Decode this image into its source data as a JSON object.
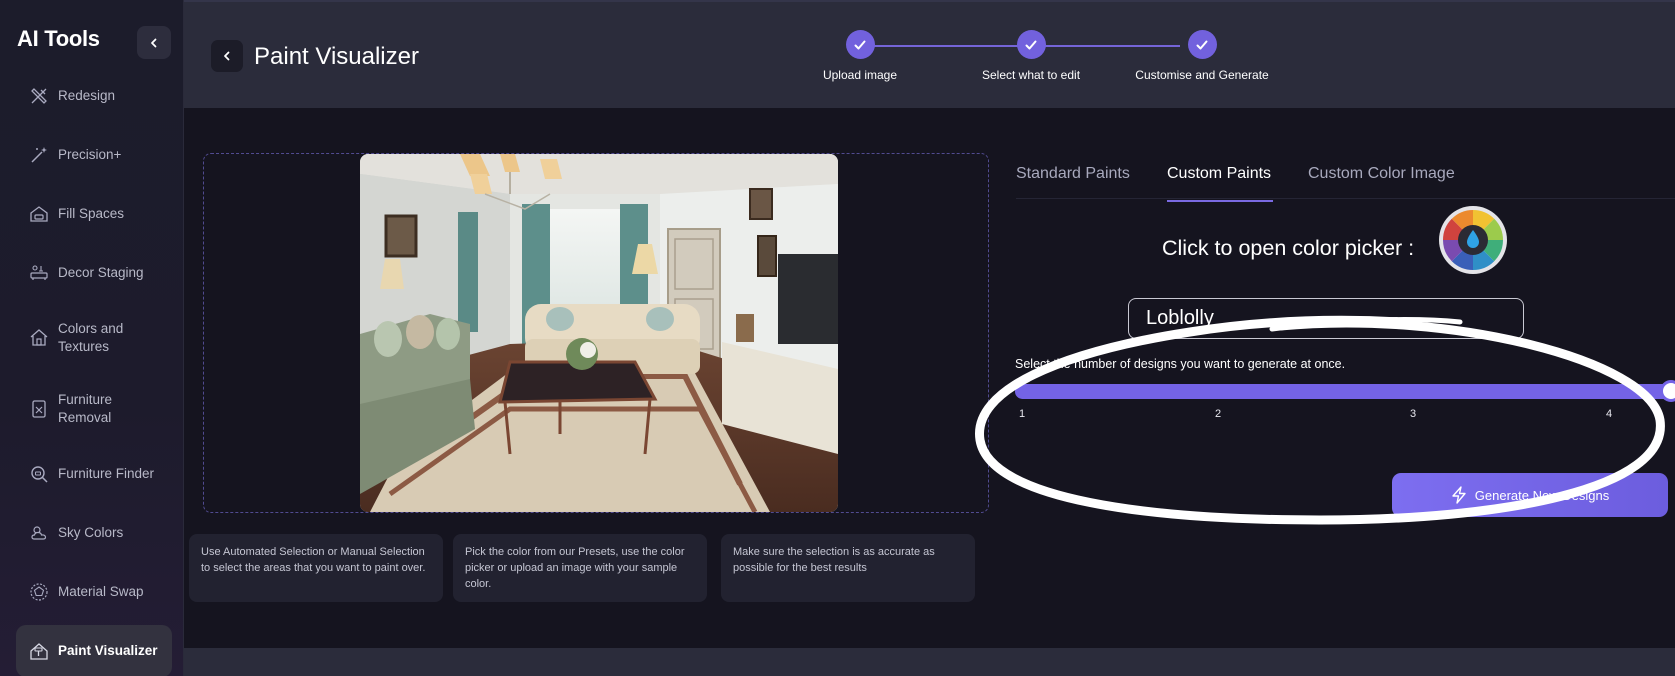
{
  "sidebar": {
    "brand": "AI Tools",
    "items": [
      {
        "label": "Redesign",
        "icon": "redesign-icon"
      },
      {
        "label": "Precision+",
        "icon": "magic-wand-icon"
      },
      {
        "label": "Fill Spaces",
        "icon": "fill-spaces-icon"
      },
      {
        "label": "Decor Staging",
        "icon": "decor-staging-icon"
      },
      {
        "label": "Colors and Textures",
        "icon": "house-icon"
      },
      {
        "label": "Furniture Removal",
        "icon": "furniture-removal-icon"
      },
      {
        "label": "Furniture Finder",
        "icon": "search-icon"
      },
      {
        "label": "Sky Colors",
        "icon": "sky-icon"
      },
      {
        "label": "Material Swap",
        "icon": "material-swap-icon"
      },
      {
        "label": "Paint Visualizer",
        "icon": "paint-visualizer-icon",
        "active": true
      }
    ]
  },
  "header": {
    "title": "Paint Visualizer",
    "steps": [
      {
        "label": "Upload image",
        "done": true
      },
      {
        "label": "Select what to edit",
        "done": true
      },
      {
        "label": "Customise and Generate",
        "done": true
      }
    ]
  },
  "tips": [
    "Use Automated Selection or Manual Selection to select the areas that you want to paint over.",
    "Pick the color from our Presets, use the color picker or upload an image with your sample color.",
    "Make sure the selection is as accurate as possible for the best results"
  ],
  "tabs": [
    {
      "label": "Standard Paints",
      "active": false
    },
    {
      "label": "Custom Paints",
      "active": true
    },
    {
      "label": "Custom Color Image",
      "active": false
    }
  ],
  "picker": {
    "label": "Click to open color picker :",
    "color_value": "Loblolly"
  },
  "slider": {
    "label": "Select the number of designs you want to generate at once.",
    "ticks": [
      "1",
      "2",
      "3",
      "4"
    ],
    "min": 1,
    "max": 4,
    "value": 4
  },
  "generate_button": {
    "label": "Generate New Designs"
  },
  "colors": {
    "accent": "#7463e6",
    "background": "#15141f",
    "header": "#2b2c3b"
  }
}
